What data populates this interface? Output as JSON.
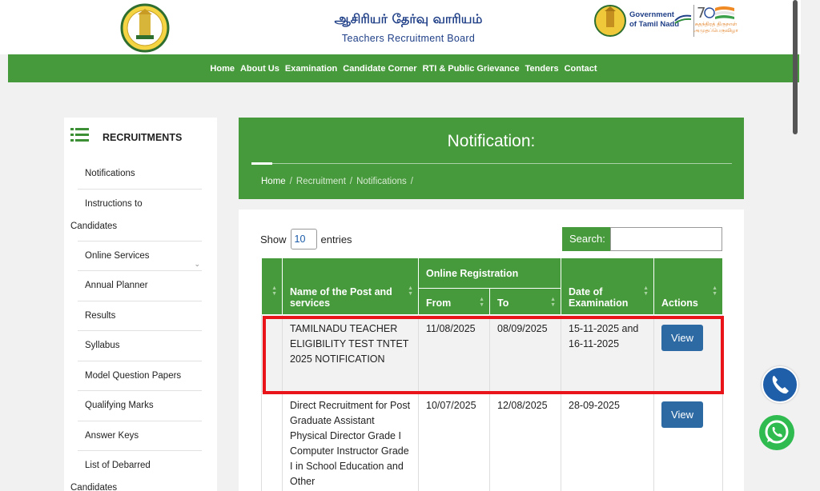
{
  "header": {
    "brand_tamil": "ஆசிரியர் தேர்வு வாரியம்",
    "brand_english": "Teachers Recruitment Board",
    "gov_line1": "Government",
    "gov_line2": "of Tamil Nadu",
    "azadi_text": "சுதந்திரத் திருநாள் அமுதப்பெருவிழா"
  },
  "nav": {
    "items": [
      "Home",
      "About Us",
      "Examination",
      "Candidate Corner",
      "RTI & Public Grievance",
      "Tenders",
      "Contact"
    ]
  },
  "sidebar": {
    "title": "RECRUITMENTS",
    "items": [
      {
        "label": "Notifications"
      },
      {
        "label_line1": "Instructions to",
        "label_line2": "Candidates"
      },
      {
        "label": "Online Services",
        "has_dropdown": true
      },
      {
        "label": "Annual Planner"
      },
      {
        "label": "Results"
      },
      {
        "label": "Syllabus"
      },
      {
        "label": "Model Question Papers"
      },
      {
        "label": "Qualifying Marks"
      },
      {
        "label": "Answer Keys"
      },
      {
        "label_line1": "List of Debarred",
        "label_line2": "Candidates"
      }
    ]
  },
  "banner": {
    "title": "Notification:",
    "breadcrumb": [
      "Home",
      "Recruitment",
      "Notifications"
    ]
  },
  "table_controls": {
    "show_label": "Show",
    "entries_value": "10",
    "entries_label": "entries",
    "search_label": "Search:"
  },
  "table": {
    "group_header": "Online Registration",
    "headers": {
      "name": "Name of the Post and services",
      "from": "From",
      "to": "To",
      "date": "Date of Examination",
      "actions": "Actions"
    },
    "rows": [
      {
        "name": "TAMILNADU TEACHER ELIGIBILITY TEST TNTET 2025 NOTIFICATION",
        "from": "11/08/2025",
        "to": "08/09/2025",
        "date": "15-11-2025 and 16-11-2025",
        "action": "View"
      },
      {
        "name": "Direct Recruitment for Post Graduate Assistant Physical Director Grade I Computer Instructor Grade I in School Education and Other",
        "from": "10/07/2025",
        "to": "12/08/2025",
        "date": "28-09-2025",
        "action": "View"
      }
    ]
  },
  "colors": {
    "primary_green": "#479a3c",
    "view_button": "#2d6aa3",
    "highlight": "#e8141a"
  }
}
